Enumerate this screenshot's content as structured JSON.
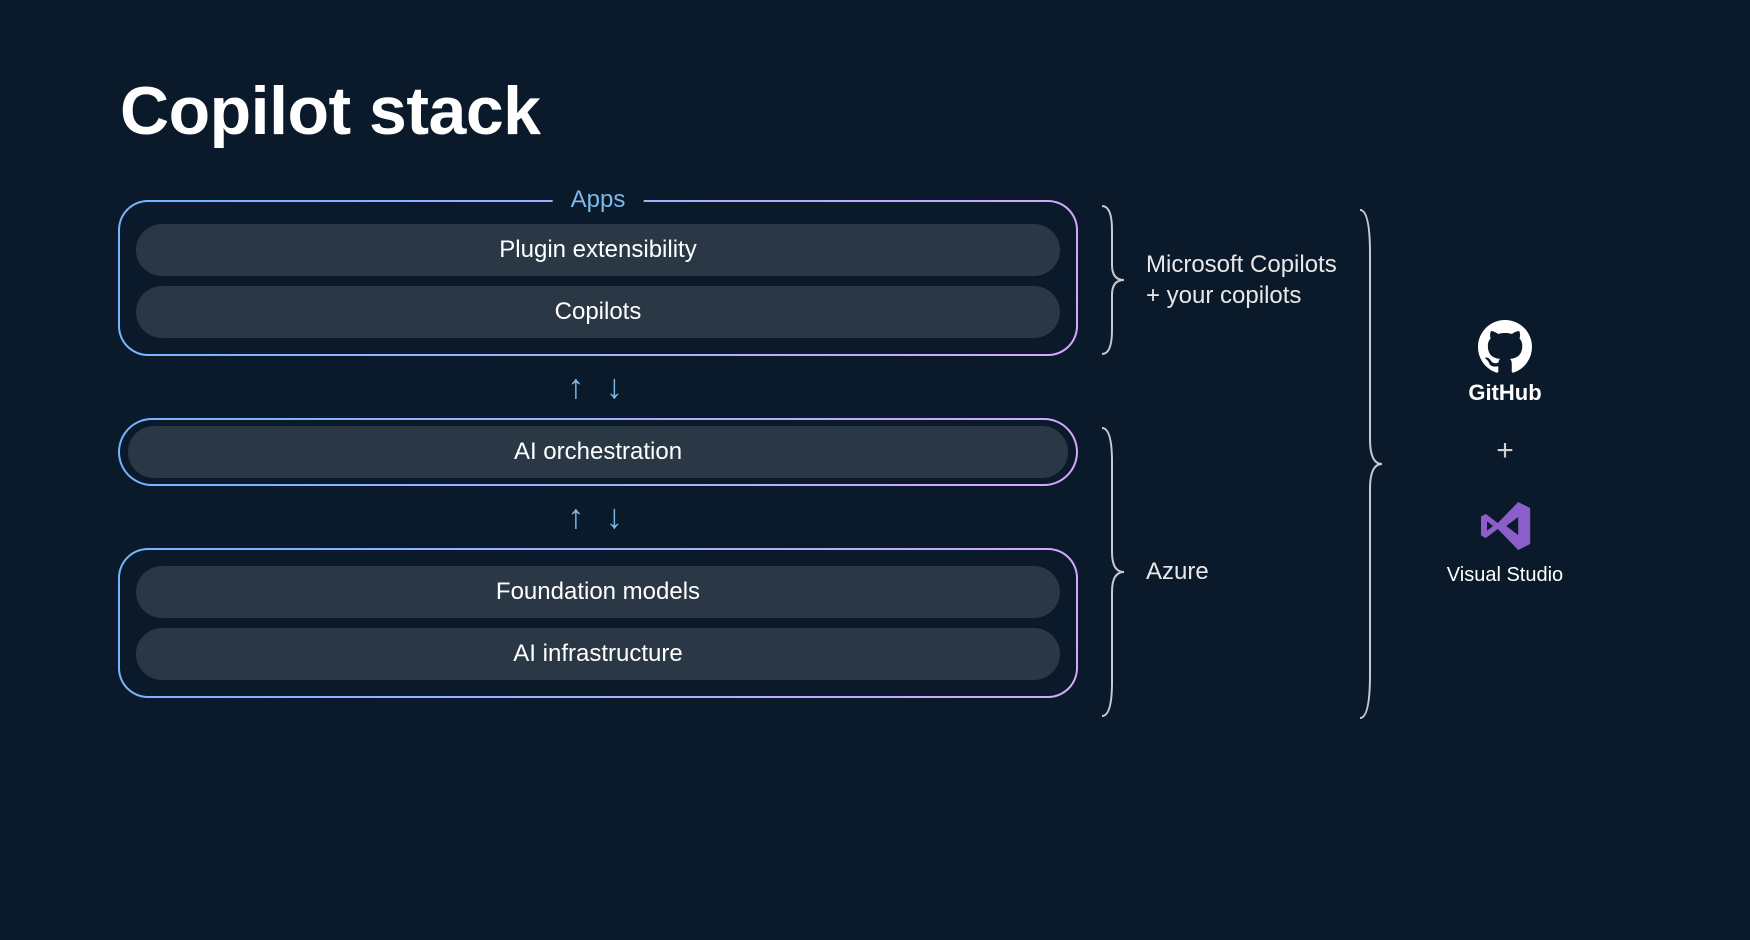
{
  "title": "Copilot stack",
  "stack": {
    "apps": {
      "label": "Apps",
      "items": [
        "Plugin extensibility",
        "Copilots"
      ]
    },
    "orchestration": {
      "label": "AI orchestration"
    },
    "foundation": {
      "items": [
        "Foundation models",
        "AI infrastructure"
      ]
    }
  },
  "braces": {
    "top_label_line1": "Microsoft Copilots",
    "top_label_line2": "+ your copilots",
    "bottom_label": "Azure"
  },
  "right": {
    "github": "GitHub",
    "plus": "+",
    "visual_studio": "Visual Studio"
  },
  "arrows_glyph": "↑ ↓",
  "icons": {
    "github": "github-icon",
    "visual_studio": "visual-studio-icon"
  },
  "colors": {
    "background": "#0b1a2a",
    "pill_bg": "#2a3846",
    "accent_blue": "#6fb6ff",
    "accent_purple": "#d9a7ff",
    "label_blue": "#7db8e8",
    "vs_purple": "#8c5ec9"
  }
}
